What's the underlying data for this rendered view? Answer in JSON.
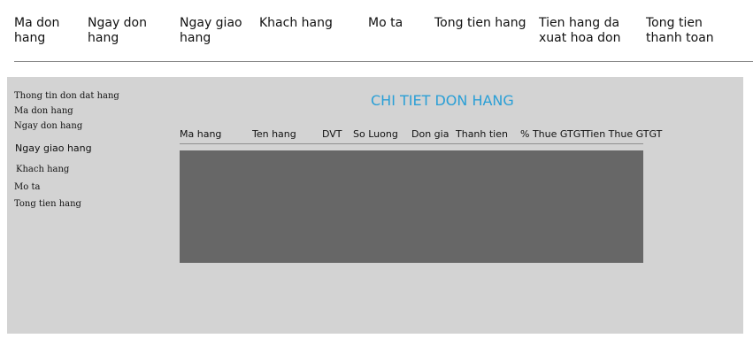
{
  "header": {
    "columns": [
      "Ma don\nhang",
      "Ngay don\nhang",
      "Ngay giao\nhang",
      "Khach hang",
      "Mo ta",
      "Tong tien hang",
      "Tien hang da\nxuat hoa don",
      "Tong tien\nthanh toan"
    ]
  },
  "detail": {
    "info_labels": [
      "Thong tin don dat hang",
      "Ma don hang",
      "Ngay don hang",
      "Ngay giao hang",
      "Khach hang",
      "Mo ta",
      "Tong tien hang"
    ],
    "title": "CHI TIET DON HANG",
    "columns": [
      "Ma hang",
      "Ten hang",
      "DVT",
      "So Luong",
      "Don gia",
      "Thanh tien",
      "% Thue GTGT",
      "Tien Thue GTGT"
    ]
  },
  "colors": {
    "title_accent": "#2a9fd6",
    "panel_background": "#d3d3d3",
    "grid_body": "#676767"
  }
}
